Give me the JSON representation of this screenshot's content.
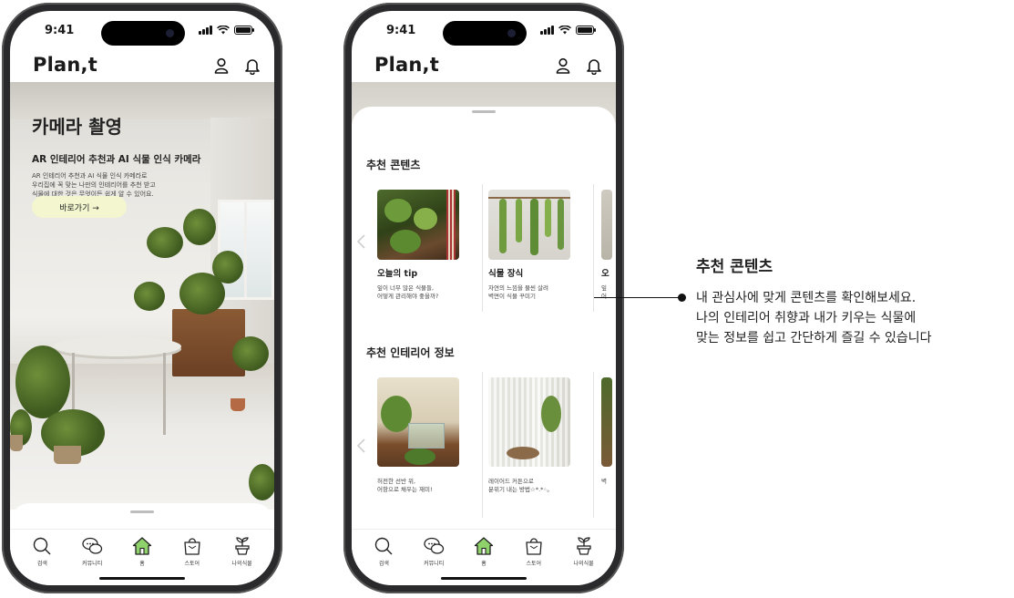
{
  "status": {
    "time": "9:41"
  },
  "app": {
    "logo": "Plan,t"
  },
  "hero": {
    "title": "카메라 촬영",
    "subtitle": "AR 인테리어 추천과 AI 식물 인식 카메라",
    "desc_lines": [
      "AR 인테리어 추천과 AI 식물 인식 카메라로",
      "우리집에 꼭 맞는 나만의 인테리어를 추천 받고",
      "식물에 대한 것은 무엇이든 쉽게 알 수 있어요."
    ],
    "button": "바로가기 →"
  },
  "tabs": [
    {
      "label": "검색",
      "icon": "search-icon"
    },
    {
      "label": "커뮤니티",
      "icon": "chat-bubbles-icon"
    },
    {
      "label": "홈",
      "icon": "home-icon"
    },
    {
      "label": "스토어",
      "icon": "shopping-bag-icon"
    },
    {
      "label": "나의식물",
      "icon": "plant-pot-icon"
    }
  ],
  "content": {
    "section1_title": "추천 콘텐츠",
    "section1_cards": [
      {
        "title": "오늘의 tip",
        "desc_lines": [
          "잎이 너무 많은 식물들,",
          "어떻게 관리해야 좋을까?"
        ]
      },
      {
        "title": "식물 장식",
        "desc_lines": [
          "자연의 느낌을 물씬 살려",
          "벽면이 식물 꾸미기"
        ]
      },
      {
        "title": "오",
        "desc_lines": [
          "잎",
          "어"
        ]
      }
    ],
    "section2_title": "추천 인테리어 정보",
    "section2_cards": [
      {
        "desc_lines": [
          "허전한 선반 위,",
          "어항으로 채우는 재미!"
        ]
      },
      {
        "desc_lines": [
          "레이어드 커튼으로",
          "분위기 내는 방법☆*.*◦。"
        ]
      },
      {
        "desc_lines": [
          "벽"
        ]
      }
    ]
  },
  "annotation": {
    "title": "추천 콘텐츠",
    "body_lines": [
      "내 관심사에 맞게 콘텐츠를 확인해보세요.",
      "나의 인테리어 취향과 내가 키우는 식물에",
      "맞는 정보를 쉽고 간단하게 즐길 수 있습니다"
    ]
  },
  "colors": {
    "accent": "#8fd16a",
    "hero_button": "#f3f6cf"
  }
}
